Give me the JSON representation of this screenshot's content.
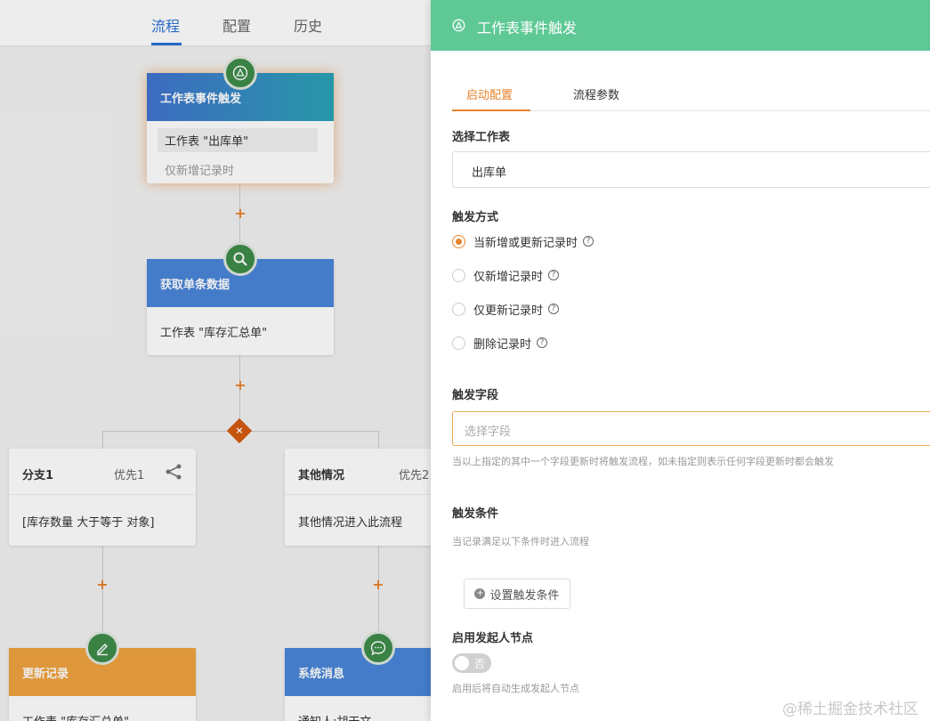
{
  "nav": {
    "tabs": [
      "流程",
      "配置",
      "历史"
    ],
    "active": 0
  },
  "flow": {
    "trigger": {
      "title": "工作表事件触发",
      "line1": "工作表 \"出库单\"",
      "line2": "仅新增记录时",
      "color": "#2ba3b6"
    },
    "fetch": {
      "title": "获取单条数据",
      "line1": "工作表 \"库存汇总单\"",
      "color": "#4a86d9"
    },
    "branch1": {
      "title": "分支1",
      "priority": "优先1",
      "condition": "[库存数量 大于等于 对象]"
    },
    "branch2": {
      "title": "其他情况",
      "priority": "优先2",
      "condition": "其他情况进入此流程"
    },
    "update": {
      "title": "更新记录",
      "line1": "工作表 \"库存汇总单\"",
      "color": "#f0a340"
    },
    "message": {
      "title": "系统消息",
      "line1": "通知人:胡天文",
      "color": "#4a86d9"
    }
  },
  "panel": {
    "title": "工作表事件触发",
    "header_color": "#5fc996",
    "tabs": [
      "启动配置",
      "流程参数"
    ],
    "active_tab": 0,
    "sheet_label": "选择工作表",
    "sheet_value": "出库单",
    "trigger_label": "触发方式",
    "trigger_options": [
      "当新增或更新记录时",
      "仅新增记录时",
      "仅更新记录时",
      "删除记录时"
    ],
    "trigger_selected": 0,
    "field_label": "触发字段",
    "field_placeholder": "选择字段",
    "field_hint": "当以上指定的其中一个字段更新时将触发流程，如未指定则表示任何字段更新时都会触发",
    "condition_label": "触发条件",
    "condition_hint": "当记录满足以下条件时进入流程",
    "condition_button": "设置触发条件",
    "initiator_label": "启用发起人节点",
    "toggle_text": "否",
    "initiator_hint": "启用后将自动生成发起人节点"
  },
  "watermark": "@稀土掘金技术社区"
}
